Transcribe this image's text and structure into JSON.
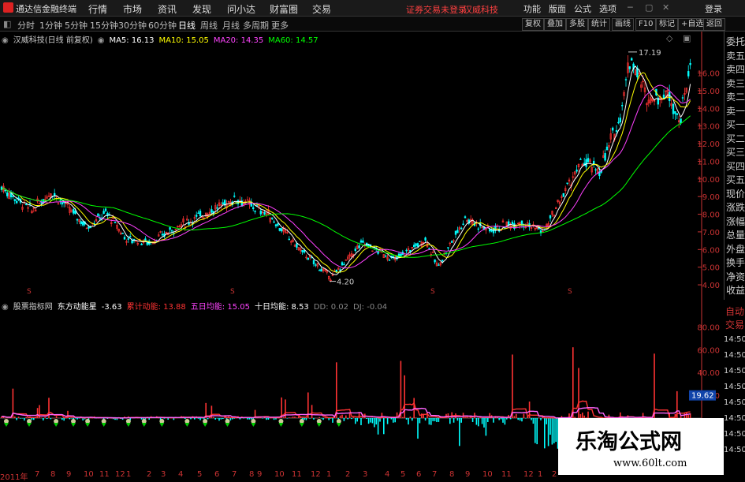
{
  "menubar": {
    "app_title": "通达信金融终端",
    "items": [
      "行情",
      "市场",
      "资讯",
      "发现",
      "问小达",
      "财富圈",
      "交易"
    ],
    "notice": "证券交易未登录",
    "stock": "汉威科技",
    "right_items": [
      "功能",
      "版面",
      "公式",
      "选项"
    ],
    "login": "登录"
  },
  "periodbar": {
    "periods": [
      "分时",
      "1分钟",
      "5分钟",
      "15分钟",
      "30分钟",
      "60分钟",
      "日线",
      "周线",
      "月线",
      "多周期",
      "更多"
    ],
    "active": "日线",
    "tools": [
      "复权",
      "叠加",
      "多股",
      "统计",
      "画线",
      "F10",
      "标记",
      "+自选",
      "返回"
    ]
  },
  "main_info": {
    "title": "汉威科技(日线 前复权)",
    "ma5": "MA5: 16.13",
    "ma10": "MA10: 15.05",
    "ma20": "MA20: 14.35",
    "ma60": "MA60: 14.57"
  },
  "price_axis": [
    "16.00",
    "15.00",
    "14.00",
    "13.00",
    "12.00",
    "11.00",
    "10.00",
    "9.00",
    "8.00",
    "7.00",
    "6.00",
    "5.00",
    "4.00"
  ],
  "annotations": {
    "high": "17.19",
    "low": "4.20"
  },
  "indicator_info": {
    "label": "股票指标网",
    "name": "东方动能星",
    "value": "-3.63",
    "cum_label": "累计动能: 13.88",
    "five_label": "五日均能: 15.05",
    "ten_label": "十日均能: 8.53",
    "dd": "DD: 0.02",
    "dj": "DJ: -0.04"
  },
  "indicator_axis": [
    "80.00",
    "60.00",
    "40.00",
    "20.00"
  ],
  "indicator_current": "19.62",
  "right_panel": [
    "委托",
    "卖五",
    "卖四",
    "卖三",
    "卖二",
    "卖一",
    "买一",
    "买二",
    "买三",
    "买四",
    "买五",
    "现价",
    "涨跌",
    "涨幅",
    "总量",
    "外盘",
    "换手",
    "净资",
    "收益"
  ],
  "right_panel2": [
    "自动",
    "交易"
  ],
  "time_col": [
    "14:50",
    "14:50",
    "14:50",
    "14:50",
    "14:50",
    "14:50",
    "14:50",
    "14:50"
  ],
  "date_axis": [
    "2011年",
    "7",
    "8",
    "9",
    "10",
    "11",
    "12",
    "1",
    "2",
    "3",
    "4",
    "5",
    "6",
    "7",
    "8",
    "9",
    "10",
    "11",
    "12",
    "1",
    "2",
    "3",
    "4",
    "5",
    "6",
    "7",
    "8",
    "9",
    "10",
    "11",
    "12",
    "1",
    "2"
  ],
  "watermark": {
    "title": "乐淘公式网",
    "url": "www.60lt.com"
  },
  "colors": {
    "ma5": "#ffffff",
    "ma10": "#ffff00",
    "ma20": "#ff40ff",
    "ma60": "#00ff00",
    "up": "#ff3333",
    "down": "#00ffff",
    "axis": "#c33"
  }
}
